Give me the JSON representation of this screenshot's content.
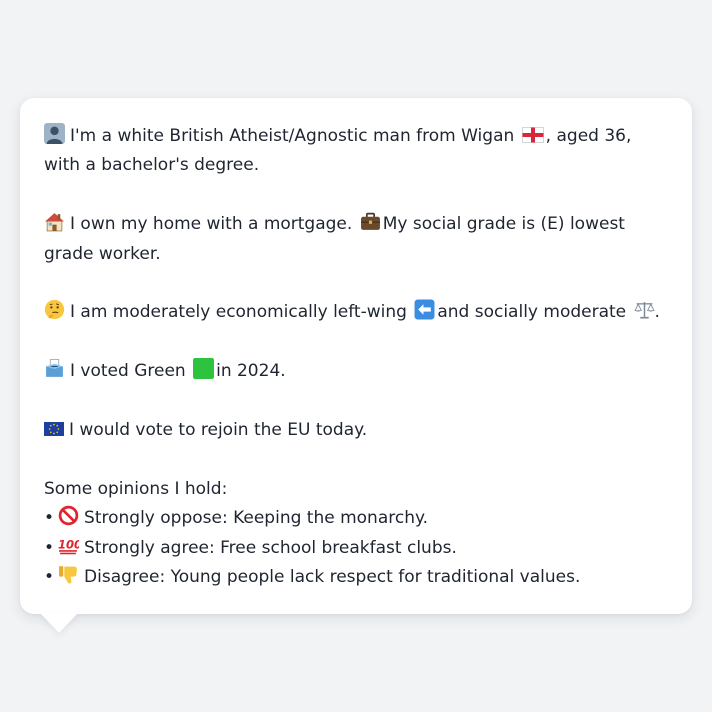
{
  "persona": {
    "identity": {
      "emoji": "person-silhouette-icon",
      "text_before_flag": "I'm a white British Atheist/Agnostic man from Wigan",
      "flag": "england-flag-icon",
      "text_after_flag": ", aged 36, with a bachelor's degree."
    },
    "home": {
      "emoji": "house-icon",
      "text": "I own my home with a mortgage.",
      "grade_emoji": "briefcase-icon",
      "grade_text": "My social grade is (E) lowest grade worker."
    },
    "politics": {
      "emoji": "thinking-face-icon",
      "text_before": "I am moderately economically left-wing",
      "left_arrow": "left-arrow-icon",
      "text_middle": "and socially moderate",
      "scales": "balance-scale-icon",
      "text_end": "."
    },
    "vote": {
      "emoji": "ballot-box-icon",
      "text_before": "I voted Green",
      "green_square": "green-square-icon",
      "text_after": "in 2024."
    },
    "eu": {
      "emoji": "eu-flag-icon",
      "text": "I would vote to rejoin the EU today."
    },
    "opinions": {
      "heading": "Some opinions I hold:",
      "items": [
        {
          "bullet": "•",
          "icon": "prohibited-icon",
          "text": "Strongly oppose: Keeping the monarchy."
        },
        {
          "bullet": "•",
          "icon": "hundred-points-icon",
          "text": "Strongly agree: Free school breakfast clubs."
        },
        {
          "bullet": "•",
          "icon": "thumbs-down-icon",
          "text": "Disagree: Young people lack respect for traditional values."
        }
      ]
    }
  },
  "colors": {
    "background": "#f1f3f5",
    "card": "#ffffff",
    "text": "#1f2530",
    "green_square": "#2ec33e",
    "eu_blue": "#1f3f9e"
  }
}
